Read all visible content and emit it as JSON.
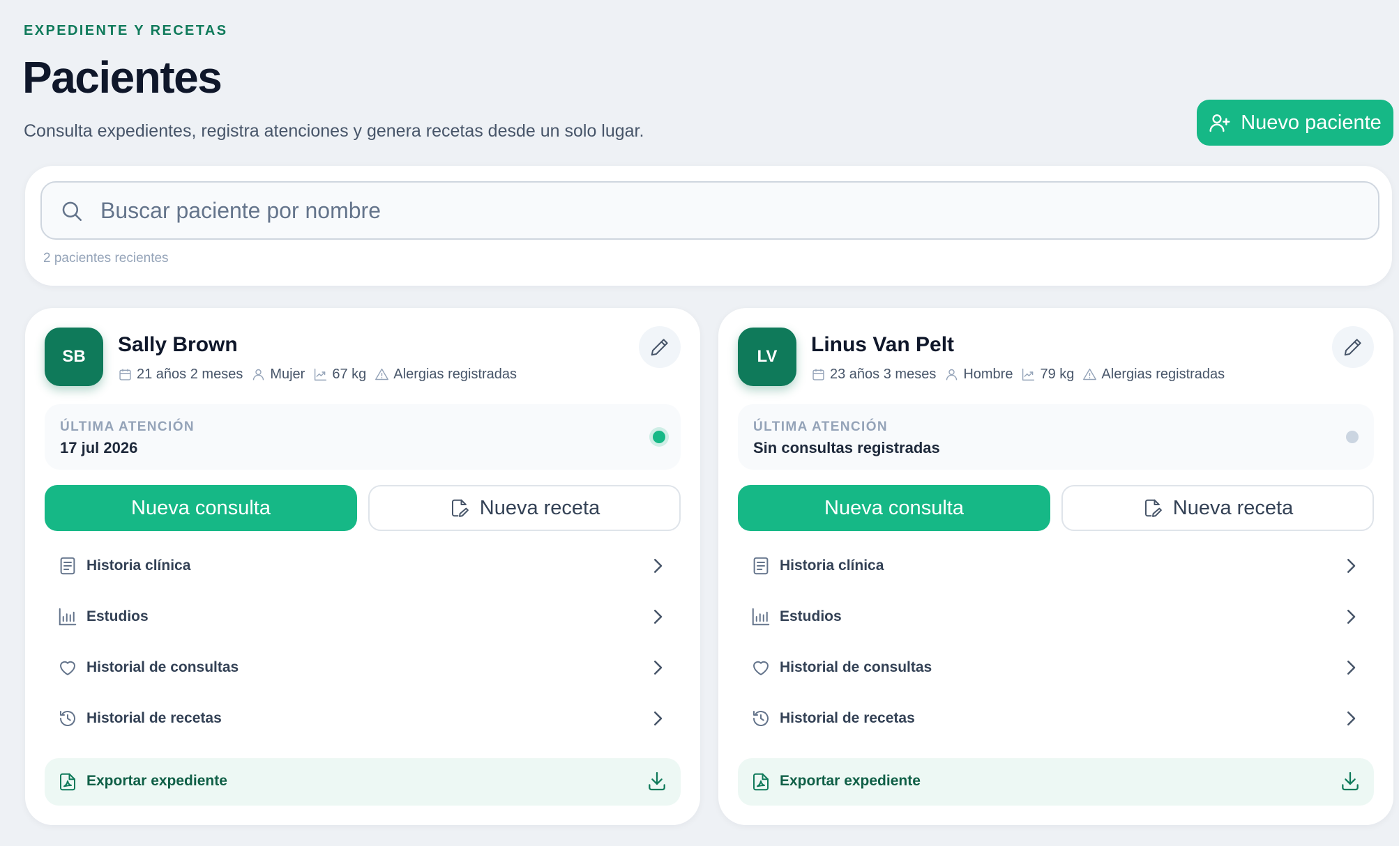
{
  "header": {
    "eyebrow": "EXPEDIENTE Y RECETAS",
    "title": "Pacientes",
    "subtitle": "Consulta expedientes, registra atenciones y genera recetas desde un solo lugar.",
    "new_patient_label": "Nuevo paciente"
  },
  "search": {
    "placeholder": "Buscar paciente por nombre",
    "value": "",
    "count_text": "2 pacientes recientes"
  },
  "colors": {
    "accent": "#16b886",
    "accent_dark": "#0f7a5a",
    "status_active": "#16b886",
    "status_inactive": "#cbd5e1"
  },
  "patients": [
    {
      "initials": "SB",
      "name": "Sally Brown",
      "age": "21 años 2 meses",
      "sex": "Mujer",
      "weight": "67 kg",
      "allergies": "Alergias registradas",
      "last_visit_label": "ÚLTIMA ATENCIÓN",
      "last_visit_value": "17 jul 2026",
      "status": "active",
      "btn_consulta": "Nueva consulta",
      "btn_receta": "Nueva receta",
      "links": [
        {
          "label": "Historia clínica",
          "icon": "document-icon"
        },
        {
          "label": "Estudios",
          "icon": "bar-chart-icon"
        },
        {
          "label": "Historial de consultas",
          "icon": "heart-icon"
        },
        {
          "label": "Historial de recetas",
          "icon": "history-icon"
        }
      ],
      "export_label": "Exportar expediente"
    },
    {
      "initials": "LV",
      "name": "Linus Van Pelt",
      "age": "23 años 3 meses",
      "sex": "Hombre",
      "weight": "79 kg",
      "allergies": "Alergias registradas",
      "last_visit_label": "ÚLTIMA ATENCIÓN",
      "last_visit_value": "Sin consultas registradas",
      "status": "inactive",
      "btn_consulta": "Nueva consulta",
      "btn_receta": "Nueva receta",
      "links": [
        {
          "label": "Historia clínica",
          "icon": "document-icon"
        },
        {
          "label": "Estudios",
          "icon": "bar-chart-icon"
        },
        {
          "label": "Historial de consultas",
          "icon": "heart-icon"
        },
        {
          "label": "Historial de recetas",
          "icon": "history-icon"
        }
      ],
      "export_label": "Exportar expediente"
    }
  ]
}
